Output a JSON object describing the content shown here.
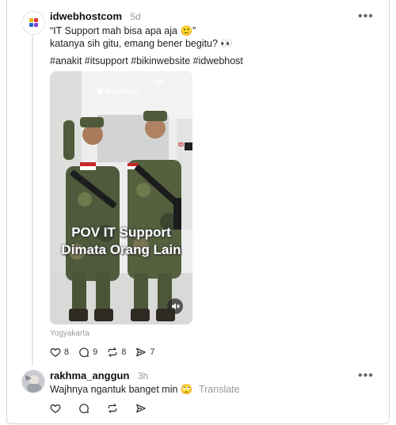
{
  "post": {
    "username": "idwebhostcom",
    "time": "5d",
    "line1": "“IT Support mah bisa apa aja 🙂”",
    "line2": "katanya sih gitu, emang bener begitu? 👀",
    "hashtags": "#anakit #itsupport #bikinwebsite #idwebhost",
    "media": {
      "brand": "IDwebhost",
      "caption_line1": "POV IT Support",
      "caption_line2": "Dimata Orang Lain",
      "side_tag": "ID"
    },
    "location": "Yogyakarta",
    "likes": "8",
    "replies": "9",
    "reposts": "8",
    "shares": "7"
  },
  "reply": {
    "username": "rakhma_anggun",
    "time": "3h",
    "text": "Wajhnya ngantuk banget min 🙄",
    "translate": "Translate"
  },
  "colors": {
    "accent": "#e53935",
    "muted": "#999999"
  }
}
